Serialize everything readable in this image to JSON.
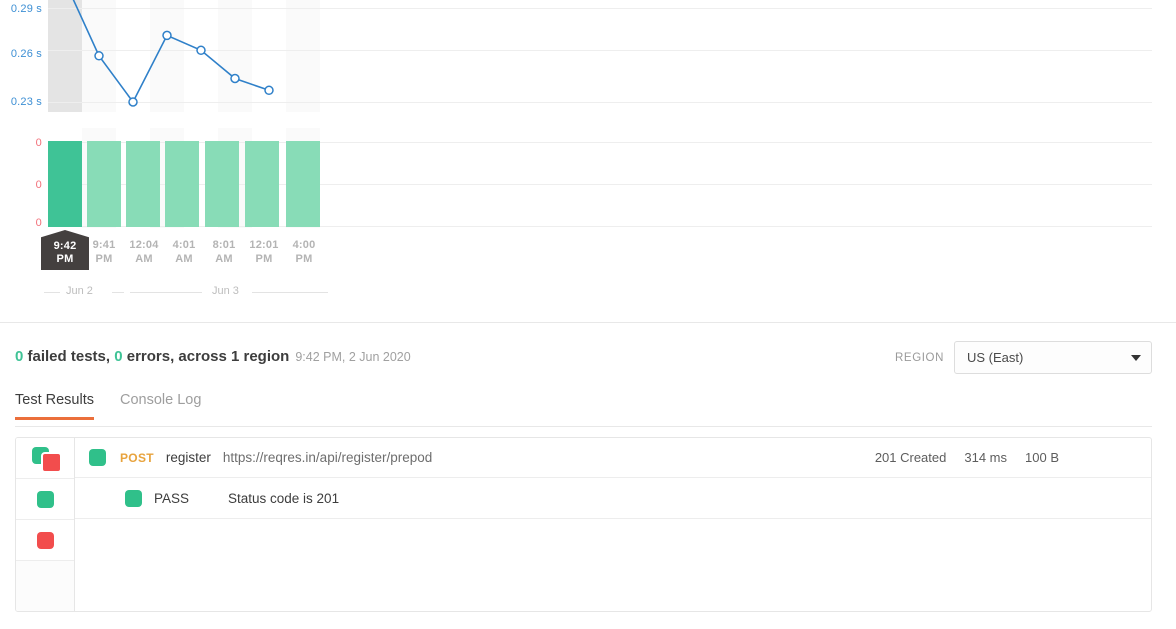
{
  "chart_data": [
    {
      "type": "line",
      "title": "",
      "ylabel": "",
      "xlabel": "",
      "ytick_labels": [
        "0.29 s",
        "0.26 s",
        "0.23 s"
      ],
      "ytick_values": [
        0.29,
        0.26,
        0.23
      ],
      "ylim": [
        0.215,
        0.305
      ],
      "grid": true,
      "legend": "none",
      "series_color": "#2f80c9",
      "categories": [
        "9:42 PM",
        "9:41 PM",
        "12:04 AM",
        "4:01 AM",
        "8:01 AM",
        "12:01 PM",
        "4:00 PM"
      ],
      "values": [
        0.307,
        0.2595,
        0.23,
        0.2725,
        0.263,
        0.245,
        0.2375
      ]
    },
    {
      "type": "bar",
      "title": "",
      "ylabel": "",
      "xlabel": "",
      "ytick_labels": [
        "0",
        "0",
        "0"
      ],
      "ytick_values": [
        0,
        0,
        0
      ],
      "grid": true,
      "legend": "none",
      "bar_color": "#88dcb7",
      "selected_bar_color": "#3fc396",
      "selected_index": 0,
      "categories": [
        "9:42 PM",
        "9:41 PM",
        "12:04 AM",
        "4:01 AM",
        "8:01 AM",
        "12:01 PM",
        "4:00 PM"
      ],
      "values": [
        1,
        1,
        1,
        1,
        1,
        1,
        1
      ]
    }
  ],
  "charts": {
    "line_axis_labels": [
      "0.29 s",
      "0.26 s",
      "0.23 s"
    ],
    "bar_axis_labels": [
      "0",
      "0",
      "0"
    ],
    "x_ticks": [
      {
        "line1": "9:42",
        "line2": "PM",
        "selected": true
      },
      {
        "line1": "9:41",
        "line2": "PM",
        "selected": false
      },
      {
        "line1": "12:04",
        "line2": "AM",
        "selected": false
      },
      {
        "line1": "4:01",
        "line2": "AM",
        "selected": false
      },
      {
        "line1": "8:01",
        "line2": "AM",
        "selected": false
      },
      {
        "line1": "12:01",
        "line2": "PM",
        "selected": false
      },
      {
        "line1": "4:00",
        "line2": "PM",
        "selected": false
      }
    ],
    "date_groups": [
      "Jun 2",
      "Jun 3"
    ]
  },
  "summary": {
    "failed_count": "0",
    "failed_text": " failed tests, ",
    "errors_count": "0",
    "errors_text": " errors, across ",
    "regions_count": "1",
    "regions_text": " region",
    "timestamp": "9:42 PM, 2 Jun 2020"
  },
  "region": {
    "label": "REGION",
    "selected": "US (East)",
    "options": [
      "US (East)"
    ]
  },
  "tabs": [
    {
      "label": "Test Results",
      "active": true
    },
    {
      "label": "Console Log",
      "active": false
    }
  ],
  "filters": [
    {
      "name": "all",
      "icon": "green-red-squares-icon"
    },
    {
      "name": "passed",
      "icon": "green-square-icon"
    },
    {
      "name": "failed",
      "icon": "red-square-icon"
    }
  ],
  "results": {
    "request": {
      "status_icon": "green-square-icon",
      "method": "POST",
      "name": "register",
      "url": "https://reqres.in/api/register/prepod",
      "status": "201 Created",
      "time": "314 ms",
      "size": "100 B"
    },
    "assertion": {
      "status_icon": "green-square-icon",
      "verdict": "PASS",
      "description": "Status code is 201"
    }
  },
  "colors": {
    "accent": "#eb6f3b",
    "pass": "#30c08a",
    "fail": "#f24d4d",
    "line": "#2f80c9",
    "bar": "#88dcb7",
    "bar_selected": "#3fc396",
    "method": "#e8a33d"
  }
}
